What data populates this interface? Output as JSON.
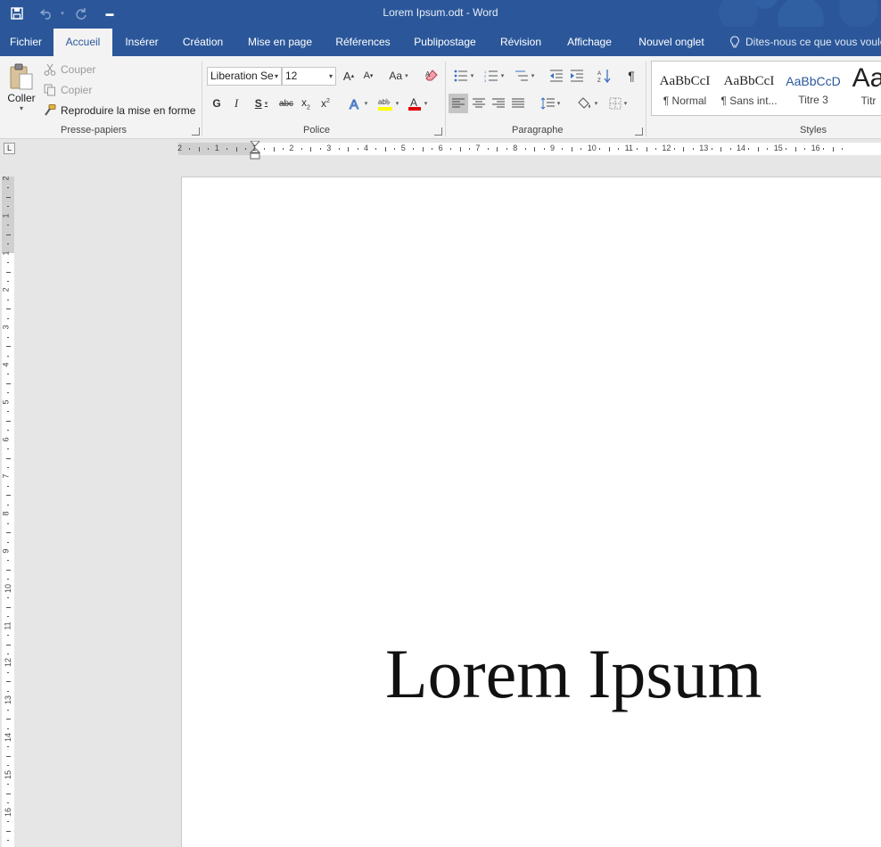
{
  "window": {
    "title": "Lorem Ipsum.odt  -  Word"
  },
  "tabs": [
    "Fichier",
    "Accueil",
    "Insérer",
    "Création",
    "Mise en page",
    "Références",
    "Publipostage",
    "Révision",
    "Affichage",
    "Nouvel onglet"
  ],
  "active_tab": "Accueil",
  "tell_me": "Dites-nous ce que vous voule",
  "clipboard": {
    "paste_label": "Coller",
    "cut_label": "Couper",
    "copy_label": "Copier",
    "format_painter_label": "Reproduire la mise en forme",
    "group_label": "Presse-papiers"
  },
  "font": {
    "name": "Liberation Se",
    "size": "12",
    "bold_label": "G",
    "italic_label": "I",
    "underline_label": "S",
    "strike_label": "abc",
    "change_case_label": "Aa",
    "grow_label": "A",
    "shrink_label": "A",
    "group_label": "Police",
    "highlight_color": "#ffff00",
    "font_color": "#e00000"
  },
  "paragraph": {
    "group_label": "Paragraphe",
    "pilcrow": "¶"
  },
  "styles": {
    "group_label": "Styles",
    "items": [
      {
        "preview": "AaBbCcI",
        "name": "¶ Normal"
      },
      {
        "preview": "AaBbCcI",
        "name": "¶ Sans int..."
      },
      {
        "preview": "AaBbCcD",
        "name": "Titre 3"
      },
      {
        "preview": "Aa",
        "name": "Titr"
      }
    ]
  },
  "ruler": {
    "h_labels": [
      "2",
      "1",
      "1",
      "2",
      "3",
      "4",
      "5",
      "6",
      "7",
      "8",
      "9",
      "10",
      "11",
      "12",
      "13",
      "14",
      "15",
      "16"
    ],
    "v_labels": [
      "2",
      "1",
      "1",
      "2",
      "3",
      "4",
      "5",
      "6",
      "7",
      "8",
      "9",
      "10",
      "11",
      "12",
      "13",
      "14",
      "15",
      "16"
    ],
    "tab_selector": "L"
  },
  "document": {
    "heading": "Lorem Ipsum"
  },
  "colors": {
    "brand": "#2b579a",
    "ribbon": "#f3f3f3"
  }
}
